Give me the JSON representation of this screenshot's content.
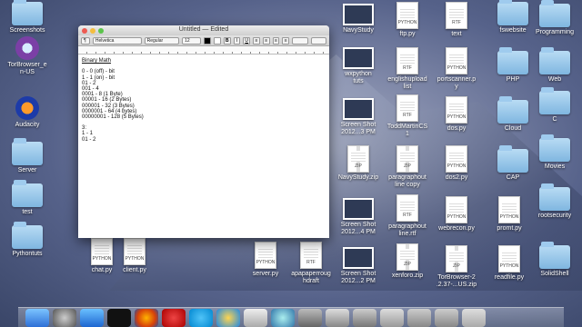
{
  "window": {
    "title": "Untitled — Edited",
    "font_family": "Helvetica",
    "font_style": "Regular",
    "font_size": "12",
    "bold": "B",
    "italic": "I",
    "underline": "U",
    "lines": [
      "Binary Math",
      "",
      "0 - 0 (off) - bit",
      "1 - 1 (on) - bit",
      "01 - 2",
      "001 - 4",
      "0001 - 8 (1 Byte)",
      "00001 - 16 (2 Bytes)",
      "000001 - 32 (3 Bytes)",
      "0000001 - 64 (4 bytes)",
      "00000001 - 128 (5 Bytes)",
      "",
      "3:",
      "1 - 1",
      "01 - 2"
    ]
  },
  "desktop": {
    "left_col": [
      {
        "label": "Screenshots"
      },
      {
        "label": "TorBrowser_e\nn-US"
      },
      {
        "label": "Audacity"
      },
      {
        "label": "Server"
      },
      {
        "label": "test"
      },
      {
        "label": "Pythontuts"
      }
    ],
    "under_window": [
      {
        "label": "chat.py",
        "badge": "PYTHON"
      },
      {
        "label": "client.py",
        "badge": "PYTHON"
      }
    ],
    "col1": [
      {
        "label": "NavyStudy"
      },
      {
        "label": "wxpython\ntuts"
      },
      {
        "label": "Screen Shot\n2012...3 PM"
      },
      {
        "label": "NavyStudy.zip",
        "badge": "ZIP"
      },
      {
        "label": "Screen Shot\n2012...4 PM"
      },
      {
        "label": "Screen Shot\n2012...2 PM"
      }
    ],
    "col_server": [
      {
        "label": "server.py",
        "badge": "PYTHON"
      },
      {
        "label": "apapaperroug\nhdraft",
        "badge": "RTF"
      }
    ],
    "col2": [
      {
        "label": "ftp.py",
        "badge": "PYTHON"
      },
      {
        "label": "englishupload\nlist",
        "badge": "RTF"
      },
      {
        "label": "ToddMartinCS\n1",
        "badge": "RTF"
      },
      {
        "label": "paragraphout\nline copy",
        "badge": "ZIP"
      },
      {
        "label": "paragraphout\nline.rtf",
        "badge": "RTF"
      },
      {
        "label": "xenforo.zip",
        "badge": "ZIP"
      }
    ],
    "col3": [
      {
        "label": "text",
        "badge": "RTF"
      },
      {
        "label": "portscanner.p\ny",
        "badge": "PYTHON"
      },
      {
        "label": "dos.py",
        "badge": "PYTHON"
      },
      {
        "label": "dos2.py",
        "badge": "PYTHON"
      },
      {
        "label": "webrecon.py",
        "badge": "PYTHON"
      },
      {
        "label": "TorBrowser-2\n.2.37-...US.zip",
        "badge": "ZIP"
      }
    ],
    "col4": [
      {
        "label": "fswebsite"
      },
      {
        "label": "PHP"
      },
      {
        "label": "Cloud"
      },
      {
        "label": "CAP"
      },
      {
        "label": "promt.py",
        "badge": "PYTHON"
      },
      {
        "label": "readfile.py",
        "badge": "PYTHON"
      }
    ],
    "col5": [
      {
        "label": "Programming"
      },
      {
        "label": "Web"
      },
      {
        "label": "C"
      },
      {
        "label": "Movies"
      },
      {
        "label": "rootsecurity"
      },
      {
        "label": "SolidShell"
      }
    ]
  }
}
